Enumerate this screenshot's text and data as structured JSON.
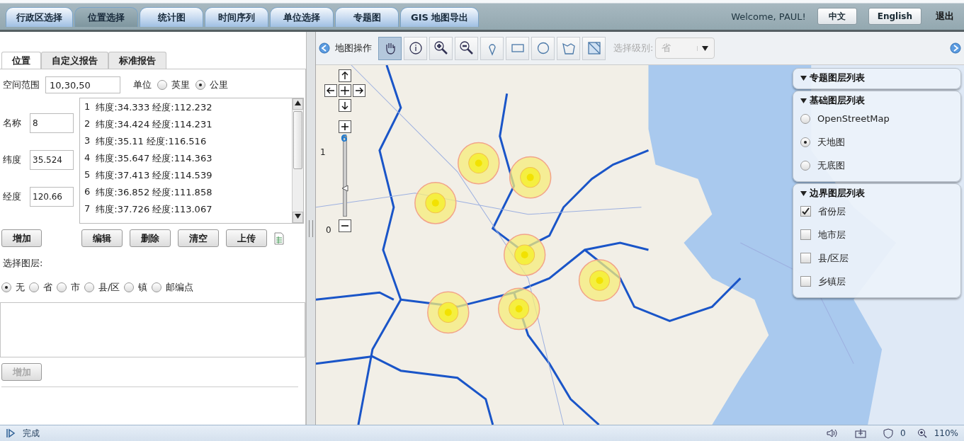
{
  "top_tabs": [
    {
      "label": "行政区选择",
      "selected": false
    },
    {
      "label": "位置选择",
      "selected": true
    },
    {
      "label": "统计图",
      "selected": false
    },
    {
      "label": "时间序列",
      "selected": false
    },
    {
      "label": "单位选择",
      "selected": false
    },
    {
      "label": "专题图",
      "selected": false
    },
    {
      "label": "GIS 地图导出",
      "selected": false
    }
  ],
  "welcome": "Welcome, PAUL!",
  "language_buttons": [
    "中文",
    "English"
  ],
  "logout": "退出",
  "left_tabs": [
    {
      "label": "位置",
      "selected": true
    },
    {
      "label": "自定义报告",
      "selected": false
    },
    {
      "label": "标准报告",
      "selected": false
    }
  ],
  "spatial_range": {
    "label": "空间范围",
    "value": "10,30,50"
  },
  "unit": {
    "label": "单位",
    "options": [
      {
        "label": "英里",
        "selected": false
      },
      {
        "label": "公里",
        "selected": true
      }
    ]
  },
  "fields": [
    {
      "label": "名称",
      "value": "8"
    },
    {
      "label": "纬度",
      "value": "35.524"
    },
    {
      "label": "经度",
      "value": "120.66"
    }
  ],
  "points": [
    {
      "number": "1",
      "text": "纬度:34.333 经度:112.232"
    },
    {
      "number": "2",
      "text": "纬度:34.424 经度:114.231"
    },
    {
      "number": "3",
      "text": "纬度:35.11 经度:116.516"
    },
    {
      "number": "4",
      "text": "纬度:35.647 经度:114.363"
    },
    {
      "number": "5",
      "text": "纬度:37.413 经度:114.539"
    },
    {
      "number": "6",
      "text": "纬度:36.852 经度:111.858"
    },
    {
      "number": "7",
      "text": "纬度:37.726 经度:113.067"
    }
  ],
  "add_button": "增加",
  "point_buttons": [
    "编辑",
    "删除",
    "清空",
    "上传"
  ],
  "layer_select": {
    "label": "选择图层:",
    "options": [
      {
        "label": "无",
        "selected": true
      },
      {
        "label": "省",
        "selected": false
      },
      {
        "label": "市",
        "selected": false
      },
      {
        "label": "县/区",
        "selected": false
      },
      {
        "label": "镇",
        "selected": false
      },
      {
        "label": "邮编点",
        "selected": false
      }
    ]
  },
  "layer_add_button": {
    "label": "增加",
    "disabled": true
  },
  "map_toolbar": {
    "title": "地图操作",
    "tools": [
      {
        "kind": "pan",
        "selected": true
      },
      {
        "kind": "info",
        "selected": false
      },
      {
        "kind": "zoom-in",
        "selected": false
      },
      {
        "kind": "zoom-out",
        "selected": false
      },
      {
        "kind": "point",
        "selected": false
      },
      {
        "kind": "rectangle",
        "selected": false
      },
      {
        "kind": "circle",
        "selected": false
      },
      {
        "kind": "polygon",
        "selected": false
      },
      {
        "kind": "clear",
        "selected": false
      }
    ],
    "level_label": "选择级别:",
    "level_value": "省",
    "level_disabled": true
  },
  "zoom_control": {
    "level_label": "6",
    "top_label": "1",
    "bottom_label": "0",
    "level": 0.35
  },
  "layer_panels": [
    {
      "title": "专题图层列表"
    },
    {
      "title": "基础图层列表",
      "kind": "radio",
      "items": [
        {
          "label": "OpenStreetMap",
          "selected": false
        },
        {
          "label": "天地图",
          "selected": true
        },
        {
          "label": "无底图",
          "selected": false
        }
      ]
    },
    {
      "title": "边界图层列表",
      "kind": "checkbox",
      "items": [
        {
          "label": "省份层",
          "selected": true
        },
        {
          "label": "地市层",
          "selected": false
        },
        {
          "label": "县/区层",
          "selected": false
        },
        {
          "label": "乡镇层",
          "selected": false
        }
      ]
    }
  ],
  "status_bar": {
    "text": "完成",
    "blocked_count": "0",
    "zoom": "110%"
  }
}
